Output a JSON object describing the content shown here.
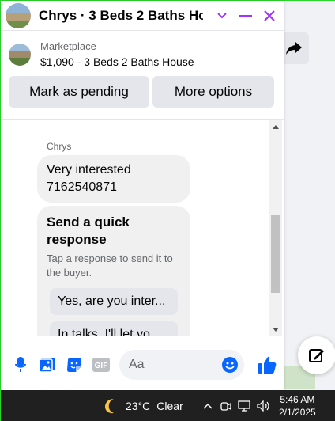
{
  "chat": {
    "title": "Chrys · 3 Beds 2 Baths Ho...",
    "listing": {
      "source": "Marketplace",
      "title": "$1,090 - 3 Beds 2 Baths House"
    },
    "actions": {
      "pending": "Mark as pending",
      "more": "More options"
    },
    "thread": {
      "sender": "Chrys",
      "message": "Very interested 7162540871",
      "quick": {
        "title": "Send a quick response",
        "subtitle": "Tap a response to send it to the buyer.",
        "options": [
          "Yes, are you inter...",
          "In talks, I'll let yo..."
        ]
      }
    },
    "composer": {
      "placeholder": "Aa"
    }
  },
  "taskbar": {
    "temperature": "23°C",
    "weather": "Clear",
    "time": "5:46 AM",
    "date": "2/1/2025"
  },
  "colors": {
    "accent": "#a033ff",
    "messenger_blue": "#0866ff"
  },
  "icons": [
    "minimize-icon",
    "close-icon",
    "chevron-down-icon",
    "share-icon",
    "compose-icon",
    "mic-icon",
    "photo-icon",
    "sticker-icon",
    "gif-icon",
    "emoji-icon",
    "like-icon",
    "moon-icon"
  ]
}
